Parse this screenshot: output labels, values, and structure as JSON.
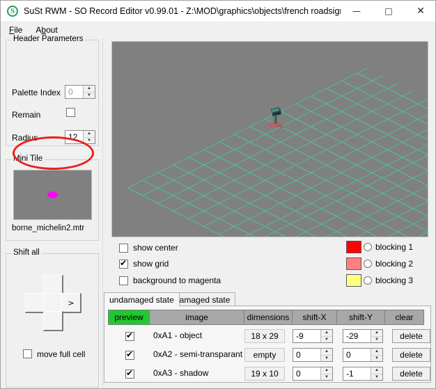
{
  "window": {
    "title": "SuSt RWM - SO Record Editor v0.99.01 - Z:\\MOD\\graphics\\objects\\french roadsigns\\...",
    "icon": "S",
    "minimize": "—",
    "maximize": "□",
    "close": "✕"
  },
  "menu": {
    "items": [
      {
        "label": "File",
        "accel": "F"
      },
      {
        "label": "About",
        "accel": "b"
      }
    ]
  },
  "header_parameters": {
    "title": "Header Parameters",
    "palette_index_label": "Palette Index",
    "palette_index_value": "0",
    "remain_label": "Remain",
    "remain_checked": false,
    "radius_label": "Radius",
    "radius_value": "12"
  },
  "mini_tile": {
    "title": "Mini Tile",
    "filename": "borne_michelin2.mtr",
    "background_color": "#808080",
    "marker_color": "#ff00ff"
  },
  "shift_all": {
    "title": "Shift all",
    "pad": {
      "up": "",
      "left": "",
      "center": "",
      "right": ">",
      "down": ""
    },
    "move_full_cell_label": "move full cell",
    "move_full_cell_checked": false
  },
  "viewport": {
    "background_color": "#808080",
    "grid_color": "#4ec194",
    "shadow_color": "#e04a4a"
  },
  "view_options": [
    {
      "label": "show center",
      "checked": false
    },
    {
      "label": "show grid",
      "checked": true
    },
    {
      "label": "background to magenta",
      "checked": false
    }
  ],
  "blocking": [
    {
      "label": "blocking 1",
      "color": "#ff0000",
      "selected": false
    },
    {
      "label": "blocking 2",
      "color": "#ff8080",
      "selected": false
    },
    {
      "label": "blocking 3",
      "color": "#ffff80",
      "selected": false
    }
  ],
  "tabs": [
    {
      "label": "undamaged state",
      "active": true
    },
    {
      "label": "damaged state",
      "active": false
    }
  ],
  "table": {
    "columns": [
      "preview",
      "image",
      "dimensions",
      "shift-X",
      "shift-Y",
      "clear"
    ],
    "rows": [
      {
        "preview_checked": true,
        "image": "0xA1 - object",
        "dimensions": "18 x 29",
        "shift_x": "-9",
        "shift_y": "-29",
        "clear_label": "delete"
      },
      {
        "preview_checked": true,
        "image": "0xA2 - semi-transparant",
        "dimensions": "empty",
        "shift_x": "0",
        "shift_y": "0",
        "clear_label": "delete"
      },
      {
        "preview_checked": true,
        "image": "0xA3 - shadow",
        "dimensions": "19 x 10",
        "shift_x": "0",
        "shift_y": "-1",
        "clear_label": "delete"
      }
    ]
  },
  "annotation": {
    "shape": "ellipse",
    "color": "#e8201c",
    "targets": "Remain"
  }
}
